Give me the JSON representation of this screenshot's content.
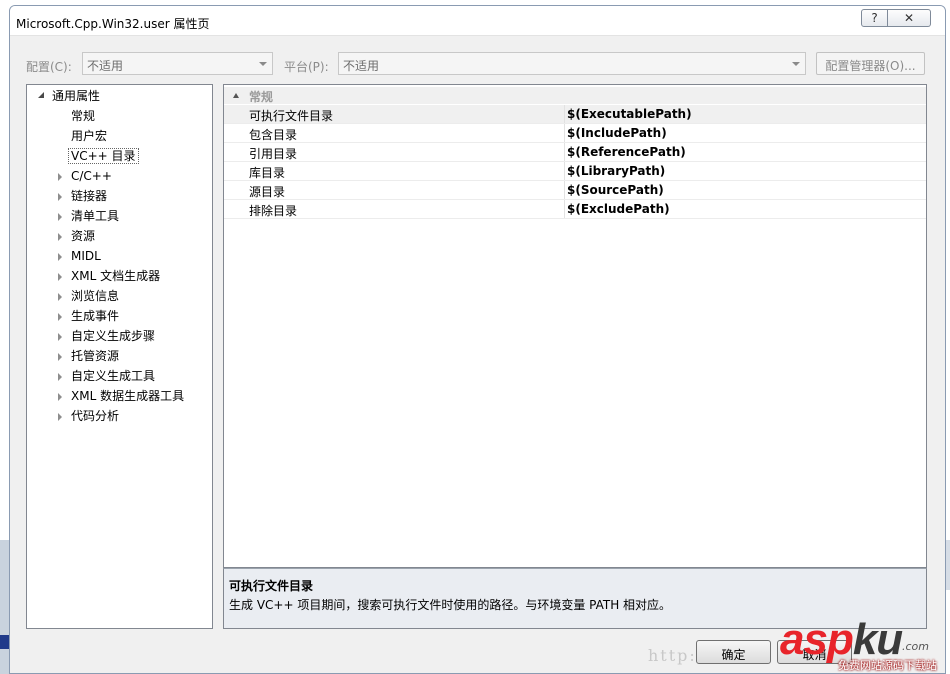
{
  "window": {
    "title": "Microsoft.Cpp.Win32.user 属性页",
    "help_glyph": "?",
    "close_glyph": "✕"
  },
  "toolbar": {
    "config_label": "配置(C):",
    "config_value": "不适用",
    "platform_label": "平台(P):",
    "platform_value": "不适用",
    "config_manager_button": "配置管理器(O)..."
  },
  "tree": {
    "root": "通用属性",
    "items": [
      {
        "label": "常规",
        "expandable": false
      },
      {
        "label": "用户宏",
        "expandable": false
      },
      {
        "label": "VC++ 目录",
        "expandable": false,
        "selected": true
      },
      {
        "label": "C/C++",
        "expandable": true
      },
      {
        "label": "链接器",
        "expandable": true
      },
      {
        "label": "清单工具",
        "expandable": true
      },
      {
        "label": "资源",
        "expandable": true
      },
      {
        "label": "MIDL",
        "expandable": true
      },
      {
        "label": "XML 文档生成器",
        "expandable": true
      },
      {
        "label": "浏览信息",
        "expandable": true
      },
      {
        "label": "生成事件",
        "expandable": true
      },
      {
        "label": "自定义生成步骤",
        "expandable": true
      },
      {
        "label": "托管资源",
        "expandable": true
      },
      {
        "label": "自定义生成工具",
        "expandable": true
      },
      {
        "label": "XML 数据生成器工具",
        "expandable": true
      },
      {
        "label": "代码分析",
        "expandable": true
      }
    ]
  },
  "grid": {
    "category": "常规",
    "rows": [
      {
        "name": "可执行文件目录",
        "value": "$(ExecutablePath)",
        "selected": true
      },
      {
        "name": "包含目录",
        "value": "$(IncludePath)"
      },
      {
        "name": "引用目录",
        "value": "$(ReferencePath)"
      },
      {
        "name": "库目录",
        "value": "$(LibraryPath)"
      },
      {
        "name": "源目录",
        "value": "$(SourcePath)"
      },
      {
        "name": "排除目录",
        "value": "$(ExcludePath)"
      }
    ]
  },
  "description": {
    "title": "可执行文件目录",
    "text": "生成 VC++ 项目期间，搜索可执行文件时使用的路径。与环境变量 PATH 相对应。"
  },
  "buttons": {
    "ok": "确定",
    "cancel": "取消"
  },
  "watermark": {
    "url": "http://",
    "logo_asp": "asp",
    "logo_ku": "ku",
    "logo_com": ".com",
    "subtitle": "免费网站源码下载站"
  }
}
